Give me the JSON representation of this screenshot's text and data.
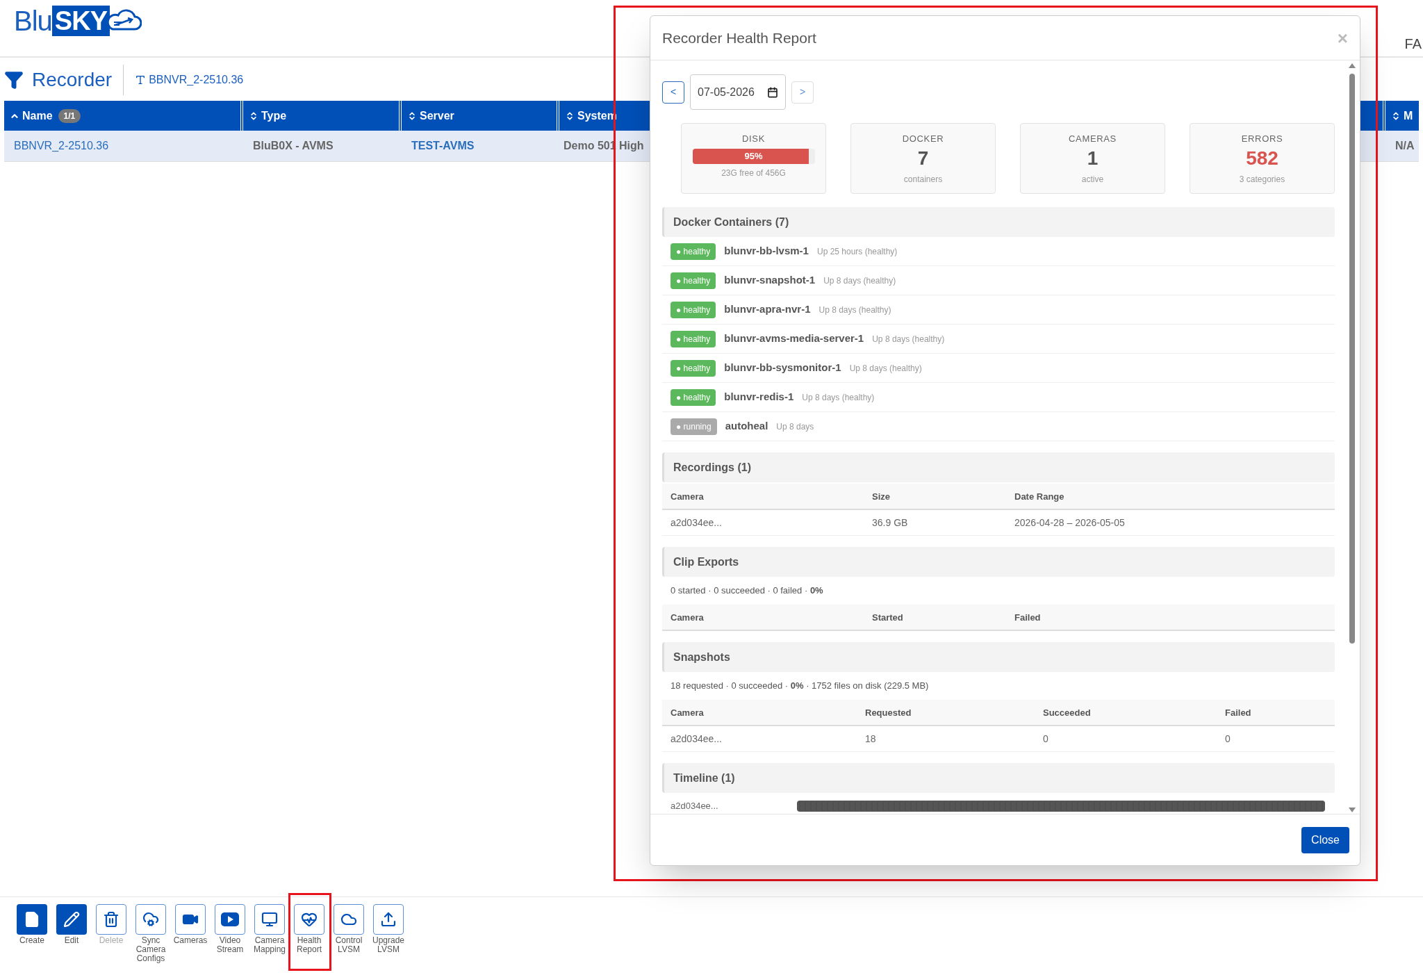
{
  "header": {
    "logo": {
      "light": "Blu",
      "bold": "SKY"
    },
    "right_text": "FA"
  },
  "page": {
    "title": "Recorder",
    "filter": "BBNVR_2-2510.36"
  },
  "table": {
    "columns": [
      {
        "label": "Name",
        "sorted": true,
        "badge": "1/1"
      },
      {
        "label": "Type",
        "sorted": false
      },
      {
        "label": "Server",
        "sorted": false
      },
      {
        "label": "System",
        "sorted": false
      },
      {
        "label": "M",
        "sorted": false
      }
    ],
    "rows": [
      {
        "selected": true,
        "cells": [
          "BBNVR_2-2510.36",
          "BluB0X - AVMS",
          "TEST-AVMS",
          "Demo 501 High",
          "N/A"
        ]
      }
    ]
  },
  "modal": {
    "title": "Recorder Health Report",
    "close_icon": "×",
    "date": {
      "prev": "<",
      "value": "07-05-2026",
      "next": ">"
    },
    "cards": [
      {
        "kind": "meter",
        "label": "DISK",
        "level": 0.95,
        "reading": "95%",
        "sub": "23G free of 456G"
      },
      {
        "kind": "number",
        "label": "DOCKER",
        "value": "7",
        "sub": "containers",
        "alert": false
      },
      {
        "kind": "number",
        "label": "CAMERAS",
        "value": "1",
        "sub": "active",
        "alert": false
      },
      {
        "kind": "number",
        "label": "ERRORS",
        "value": "582",
        "sub": "3 categories",
        "alert": true
      }
    ],
    "sections": [
      {
        "kind": "containers",
        "title": "Docker Containers (7)",
        "items": [
          {
            "status": "● healthy",
            "color": "#5cb85c",
            "name": "blunvr-bb-lvsm-1",
            "uptime": "Up 25 hours (healthy)"
          },
          {
            "status": "● healthy",
            "color": "#5cb85c",
            "name": "blunvr-snapshot-1",
            "uptime": "Up 8 days (healthy)"
          },
          {
            "status": "● healthy",
            "color": "#5cb85c",
            "name": "blunvr-apra-nvr-1",
            "uptime": "Up 8 days (healthy)"
          },
          {
            "status": "● healthy",
            "color": "#5cb85c",
            "name": "blunvr-avms-media-server-1",
            "uptime": "Up 8 days (healthy)"
          },
          {
            "status": "● healthy",
            "color": "#5cb85c",
            "name": "blunvr-bb-sysmonitor-1",
            "uptime": "Up 8 days (healthy)"
          },
          {
            "status": "● healthy",
            "color": "#5cb85c",
            "name": "blunvr-redis-1",
            "uptime": "Up 8 days (healthy)"
          },
          {
            "status": "● running",
            "color": "#aaaaaa",
            "name": "autoheal",
            "uptime": "Up 8 days"
          }
        ]
      },
      {
        "kind": "table",
        "title": "Recordings (1)",
        "columns": [
          "Camera",
          "Size",
          "Date Range"
        ],
        "rows": [
          [
            "a2d034ee...",
            "36.9 GB",
            "2026-04-28 – 2026-05-05"
          ]
        ]
      },
      {
        "kind": "table",
        "title": "Clip Exports",
        "summary": "0 started  · 0 succeeded  · 0 failed  · **0%**",
        "columns": [
          "Camera",
          "Started",
          "Failed"
        ]
      },
      {
        "kind": "table",
        "title": "Snapshots",
        "summary": "18 requested  · 0 succeeded  · **0%**  · 1752 files on disk (229.5 MB)",
        "columns": [
          "Camera",
          "Requested",
          "Succeeded",
          "Failed"
        ],
        "rows": [
          [
            "a2d034ee...",
            "18",
            "0",
            "0"
          ]
        ]
      },
      {
        "kind": "timeline",
        "title": "Timeline (1)",
        "rows": [
          {
            "camera": "a2d034ee..."
          }
        ]
      }
    ],
    "footer_button": "Close"
  },
  "toolbar": [
    {
      "kind": "create",
      "label": "Create",
      "filled": true,
      "disabled": false,
      "highlighted": false
    },
    {
      "kind": "edit",
      "label": "Edit",
      "filled": true,
      "disabled": false,
      "highlighted": false
    },
    {
      "kind": "delete",
      "label": "Delete",
      "filled": false,
      "disabled": true,
      "highlighted": false
    },
    {
      "kind": "sync",
      "label": "Sync Camera Configs",
      "filled": false,
      "disabled": false,
      "highlighted": false
    },
    {
      "kind": "cameras",
      "label": "Cameras",
      "filled": false,
      "disabled": false,
      "highlighted": false
    },
    {
      "kind": "video",
      "label": "Video Stream",
      "filled": false,
      "disabled": false,
      "highlighted": false
    },
    {
      "kind": "mapping",
      "label": "Camera Mapping",
      "filled": false,
      "disabled": false,
      "highlighted": false
    },
    {
      "kind": "health",
      "label": "Health Report",
      "filled": false,
      "disabled": false,
      "highlighted": true
    },
    {
      "kind": "control",
      "label": "Control LVSM",
      "filled": false,
      "disabled": false,
      "highlighted": false
    },
    {
      "kind": "upgrade",
      "label": "Upgrade LVSM",
      "filled": false,
      "disabled": false,
      "highlighted": false
    }
  ]
}
